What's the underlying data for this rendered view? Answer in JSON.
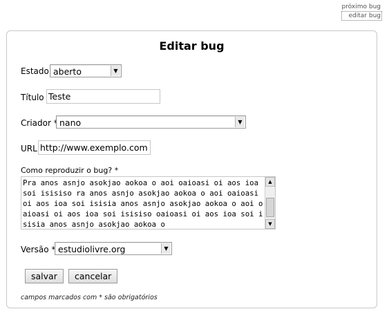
{
  "top_links": {
    "next_bug": "próximo bug",
    "edit_bug": "editar bug"
  },
  "form": {
    "title": "Editar bug",
    "estado": {
      "label": "Estado",
      "value": "aberto"
    },
    "titulo": {
      "label": "Título *",
      "value": "Teste"
    },
    "criador": {
      "label": "Criador *",
      "value": "nano"
    },
    "url": {
      "label": "URL",
      "value": "http://www.exemplo.com"
    },
    "reproduzir": {
      "label": "Como reproduzir o bug? *",
      "value": "Pra anos asnjo asokjao aokoa o aoi oaioasi oi aos ioa soi isisiso ra anos asnjo asokjao aokoa o aoi oaioasi oi aos ioa soi isisia anos asnjo asokjao aokoa o aoi oaioasi oi aos ioa soi isisiso oaioasi oi aos ioa soi isisia anos asnjo asokjao aokoa o"
    },
    "versao": {
      "label": "Versão *",
      "value": "estudiolivre.org"
    },
    "buttons": {
      "save": "salvar",
      "cancel": "cancelar"
    },
    "footnote": "campos marcados com * são obrigatórios"
  }
}
